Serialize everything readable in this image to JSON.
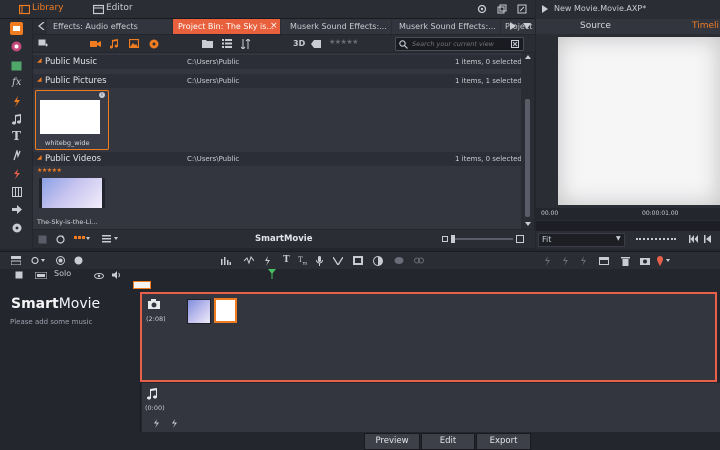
{
  "top_bar": {
    "library_label": "Library",
    "editor_label": "Editor"
  },
  "tabs": [
    {
      "label": "Effects: Audio effects"
    },
    {
      "label": "Project Bin: The Sky is..."
    },
    {
      "label": "Muserk Sound Effects:..."
    },
    {
      "label": "Muserk Sound Effects:..."
    },
    {
      "label": "Project I"
    }
  ],
  "tab_close": "×",
  "search": {
    "placeholder": "Search your current view"
  },
  "toolbar": {
    "three_d": "3D",
    "stars": "★★★★★"
  },
  "sections": [
    {
      "name": "Public Music",
      "path": "C:\\Users\\Public",
      "status": "1 items, 0 selected"
    },
    {
      "name": "Public Pictures",
      "path": "C:\\Users\\Public",
      "status": "1 items, 1 selected"
    },
    {
      "name": "Public Videos",
      "path": "C:\\Users\\Public",
      "status": "1 items, 0 selected"
    }
  ],
  "items": {
    "picture_caption": "whitebg_wide",
    "video_stars": "★★★★★",
    "video_caption": "The-Sky-is-the-Li..."
  },
  "library_bottom": {
    "smartmovie_label": "SmartMovie"
  },
  "player": {
    "title": "New Movie.Movie.AXP*",
    "source_tab": "Source",
    "timeline_tab": "Timeli",
    "time_start": "00.00",
    "time_mid": "00:00:01.00",
    "fit_label": "Fit"
  },
  "timeline_controls": {
    "solo_label": "Solo"
  },
  "smartmovie": {
    "brand_bold": "Smart",
    "brand_light": "Movie",
    "hint": "Please add some music",
    "photo_track_time": "(2:08)",
    "music_track_time": "(0:00)"
  },
  "bottom_buttons": {
    "preview": "Preview",
    "edit": "Edit",
    "export": "Export"
  },
  "colors": {
    "accent": "#f07c22",
    "highlight_red": "#e8604a",
    "tab_active": "#e8603c"
  }
}
